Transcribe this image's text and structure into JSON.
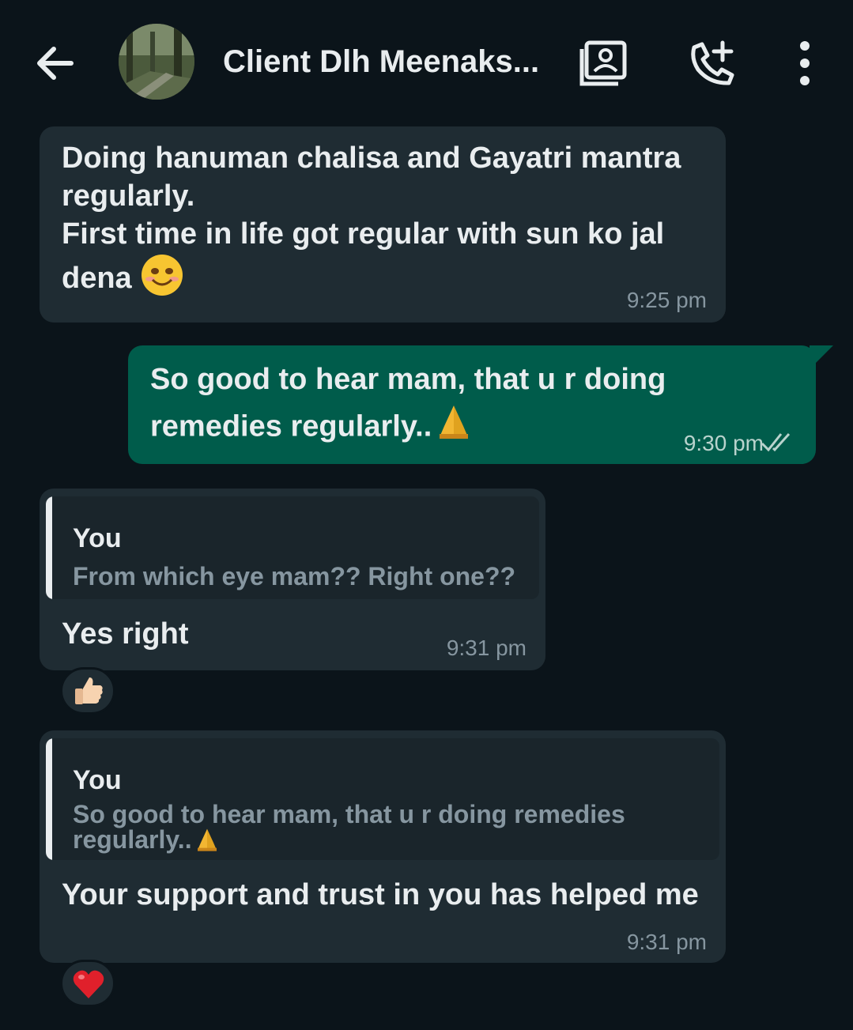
{
  "header": {
    "contact_name": "Client Dlh Meenaks...",
    "icons": {
      "back": "arrow-left-icon",
      "contact_card": "contact-card-icon",
      "call": "add-call-icon",
      "menu": "more-vert-icon"
    }
  },
  "messages": [
    {
      "direction": "incoming",
      "text": "Doing hanuman chalisa and Gayatri mantra regularly.\nFirst time in life got regular with sun ko jal dena",
      "emoji": "smiling-face-emoji",
      "time": "9:25 pm"
    },
    {
      "direction": "outgoing",
      "text": "So good to hear mam, that u r doing remedies regularly..",
      "emoji": "folded-hands-emoji",
      "time": "9:30 pm",
      "status": "read"
    },
    {
      "direction": "incoming",
      "quote": {
        "author": "You",
        "text": "From which eye mam?? Right one??"
      },
      "text": "Yes right",
      "time": "9:31 pm",
      "reaction": "thumbs-up-emoji"
    },
    {
      "direction": "incoming",
      "quote": {
        "author": "You",
        "text": "So good to hear mam, that u r doing remedies regularly..",
        "emoji": "folded-hands-emoji"
      },
      "text": "Your support and trust in you has helped me",
      "time": "9:31 pm",
      "reaction": "red-heart-emoji"
    }
  ],
  "colors": {
    "background": "#0b141a",
    "incoming_bubble": "#1f2c33",
    "outgoing_bubble": "#005c4b",
    "read_ticks": "#b9d3cd",
    "timestamp": "#8696a0"
  }
}
